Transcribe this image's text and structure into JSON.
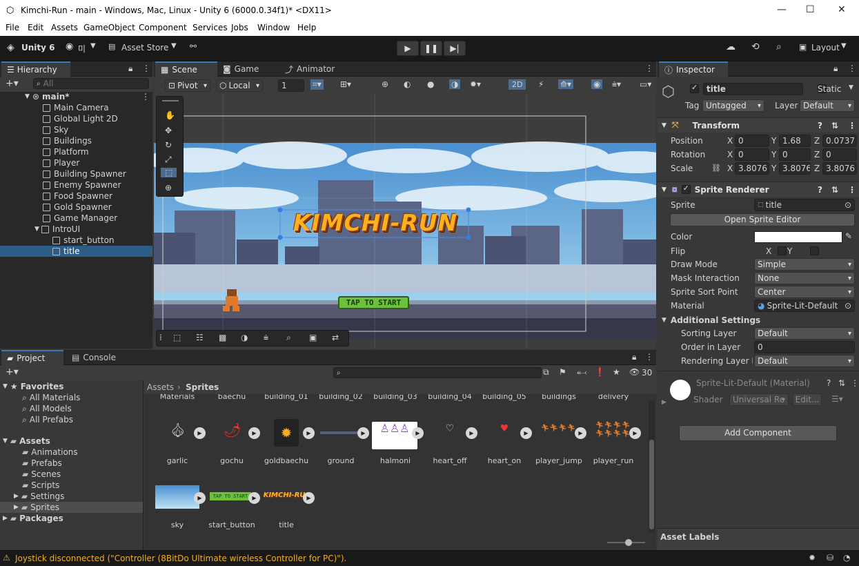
{
  "window": {
    "title": "Kimchi-Run - main - Windows, Mac, Linux - Unity 6 (6000.0.34f1)* <DX11>",
    "minimize": "—",
    "maximize": "☐",
    "close": "✕"
  },
  "menu": [
    "File",
    "Edit",
    "Assets",
    "GameObject",
    "Component",
    "Services",
    "Jobs",
    "Window",
    "Help"
  ],
  "toolbar": {
    "unity_label": "Unity 6",
    "account_label": "미",
    "asset_store": "Asset Store",
    "layout": "Layout"
  },
  "hierarchy": {
    "tab": "Hierarchy",
    "search_placeholder": "All",
    "scene": "main*",
    "items": [
      "Main Camera",
      "Global Light 2D",
      "Sky",
      "Buildings",
      "Platform",
      "Player",
      "Building Spawner",
      "Enemy Spawner",
      "Food Spawner",
      "Gold Spawner",
      "Game Manager",
      "IntroUI",
      "start_button",
      "title"
    ]
  },
  "scene_view": {
    "tabs": [
      "Scene",
      "Game",
      "Animator"
    ],
    "pivot": "Pivot",
    "local": "Local",
    "snap_value": "1",
    "mode_2d": "2D",
    "game_title": "KIMCHI-RUN",
    "start_label": "TAP TO START"
  },
  "project": {
    "tabs": [
      "Project",
      "Console"
    ],
    "count": "30",
    "breadcrumb_root": "Assets",
    "breadcrumb_leaf": "Sprites",
    "favorites_label": "Favorites",
    "favorites": [
      "All Materials",
      "All Models",
      "All Prefabs"
    ],
    "assets_label": "Assets",
    "folders": [
      "Animations",
      "Prefabs",
      "Scenes",
      "Scripts",
      "Settings",
      "Sprites"
    ],
    "packages_label": "Packages",
    "top_row": [
      "Materials",
      "baechu",
      "building_01",
      "building_02",
      "building_03",
      "building_04",
      "building_05",
      "buildings",
      "delivery"
    ],
    "row1": [
      "garlic",
      "gochu",
      "goldbaechu",
      "ground",
      "halmoni",
      "heart_off",
      "heart_on",
      "player_jump",
      "player_run"
    ],
    "row2": [
      "sky",
      "start_button",
      "title"
    ]
  },
  "inspector": {
    "tab": "Inspector",
    "object_name": "title",
    "static_label": "Static",
    "tag_label": "Tag",
    "tag_value": "Untagged",
    "layer_label": "Layer",
    "layer_value": "Default",
    "transform": {
      "title": "Transform",
      "position_label": "Position",
      "rotation_label": "Rotation",
      "scale_label": "Scale",
      "pos": [
        "0",
        "1.68",
        "0.0737"
      ],
      "rot": [
        "0",
        "0",
        "0"
      ],
      "scale": [
        "3.8076",
        "3.8076",
        "3.8076"
      ],
      "x": "X",
      "y": "Y",
      "z": "Z"
    },
    "sprite_renderer": {
      "title": "Sprite Renderer",
      "sprite_label": "Sprite",
      "sprite_value": "title",
      "open_editor": "Open Sprite Editor",
      "color_label": "Color",
      "flip_label": "Flip",
      "flip_x": "X",
      "flip_y": "Y",
      "draw_mode_label": "Draw Mode",
      "draw_mode": "Simple",
      "mask_label": "Mask Interaction",
      "mask": "None",
      "sort_point_label": "Sprite Sort Point",
      "sort_point": "Center",
      "material_label": "Material",
      "material": "Sprite-Lit-Default",
      "additional": "Additional Settings",
      "sorting_layer_label": "Sorting Layer",
      "sorting_layer": "Default",
      "order_label": "Order in Layer",
      "order": "0",
      "rendering_label": "Rendering Layer M",
      "rendering": "Default"
    },
    "material_header": "Sprite-Lit-Default (Material)",
    "shader_label": "Shader",
    "shader_value": "Universal Re",
    "edit_label": "Edit...",
    "add_component": "Add Component",
    "asset_labels": "Asset Labels"
  },
  "status": {
    "message": "Joystick disconnected (\"Controller (8BitDo Ultimate wireless Controller for PC)\")."
  }
}
